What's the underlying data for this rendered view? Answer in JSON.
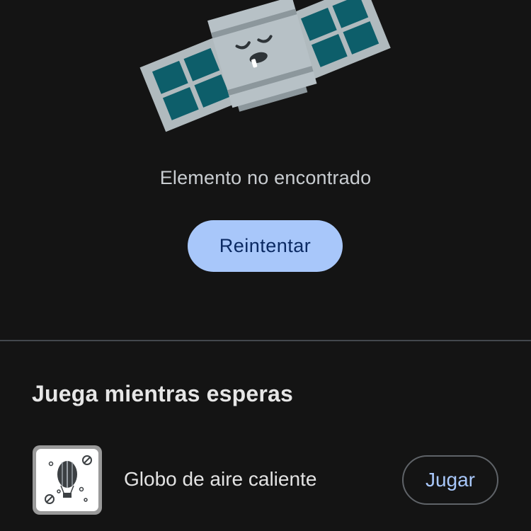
{
  "error": {
    "illustration": "sleeping-satellite-illustration",
    "message": "Elemento no encontrado",
    "retry_label": "Reintentar"
  },
  "games": {
    "section_title": "Juega mientras esperas",
    "items": [
      {
        "icon": "hot-air-balloon-icon",
        "title": "Globo de aire caliente",
        "play_label": "Jugar"
      }
    ]
  },
  "colors": {
    "background": "#141414",
    "accent": "#a8c7fa",
    "on_accent": "#0b2a63",
    "text_primary": "#e3e3e3",
    "text_secondary": "#c9cdd1",
    "divider": "#43484d"
  }
}
